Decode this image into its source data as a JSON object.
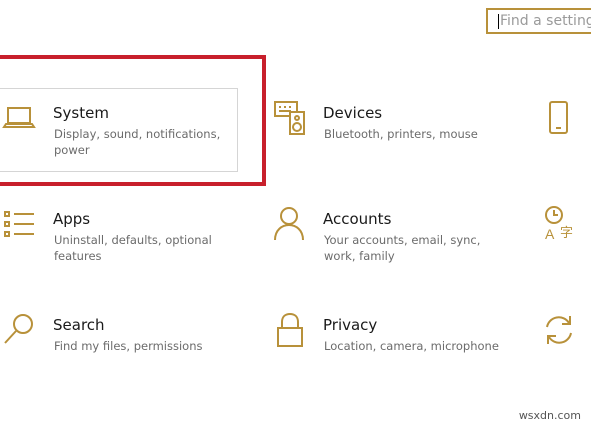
{
  "search": {
    "placeholder": "Find a setting"
  },
  "tiles": [
    {
      "title": "System",
      "desc": "Display, sound, notifications, power"
    },
    {
      "title": "Devices",
      "desc": "Bluetooth, printers, mouse"
    },
    {
      "title": "Phone",
      "desc": ""
    },
    {
      "title": "Apps",
      "desc": "Uninstall, defaults, optional features"
    },
    {
      "title": "Accounts",
      "desc": "Your accounts, email, sync, work, family"
    },
    {
      "title": "Time & Language",
      "desc": ""
    },
    {
      "title": "Search",
      "desc": "Find my files, permissions"
    },
    {
      "title": "Privacy",
      "desc": "Location, camera, microphone"
    },
    {
      "title": "Update & Security",
      "desc": ""
    }
  ],
  "icons": {
    "system": "laptop-icon",
    "devices": "keyboard-speaker-icon",
    "phone": "phone-icon",
    "apps": "apps-list-icon",
    "accounts": "person-icon",
    "time": "time-language-icon",
    "search": "magnifier-icon",
    "privacy": "lock-icon",
    "update": "sync-icon"
  },
  "colors": {
    "accent": "#b8913a",
    "highlight": "#c8202c"
  },
  "watermark": "wsxdn.com"
}
